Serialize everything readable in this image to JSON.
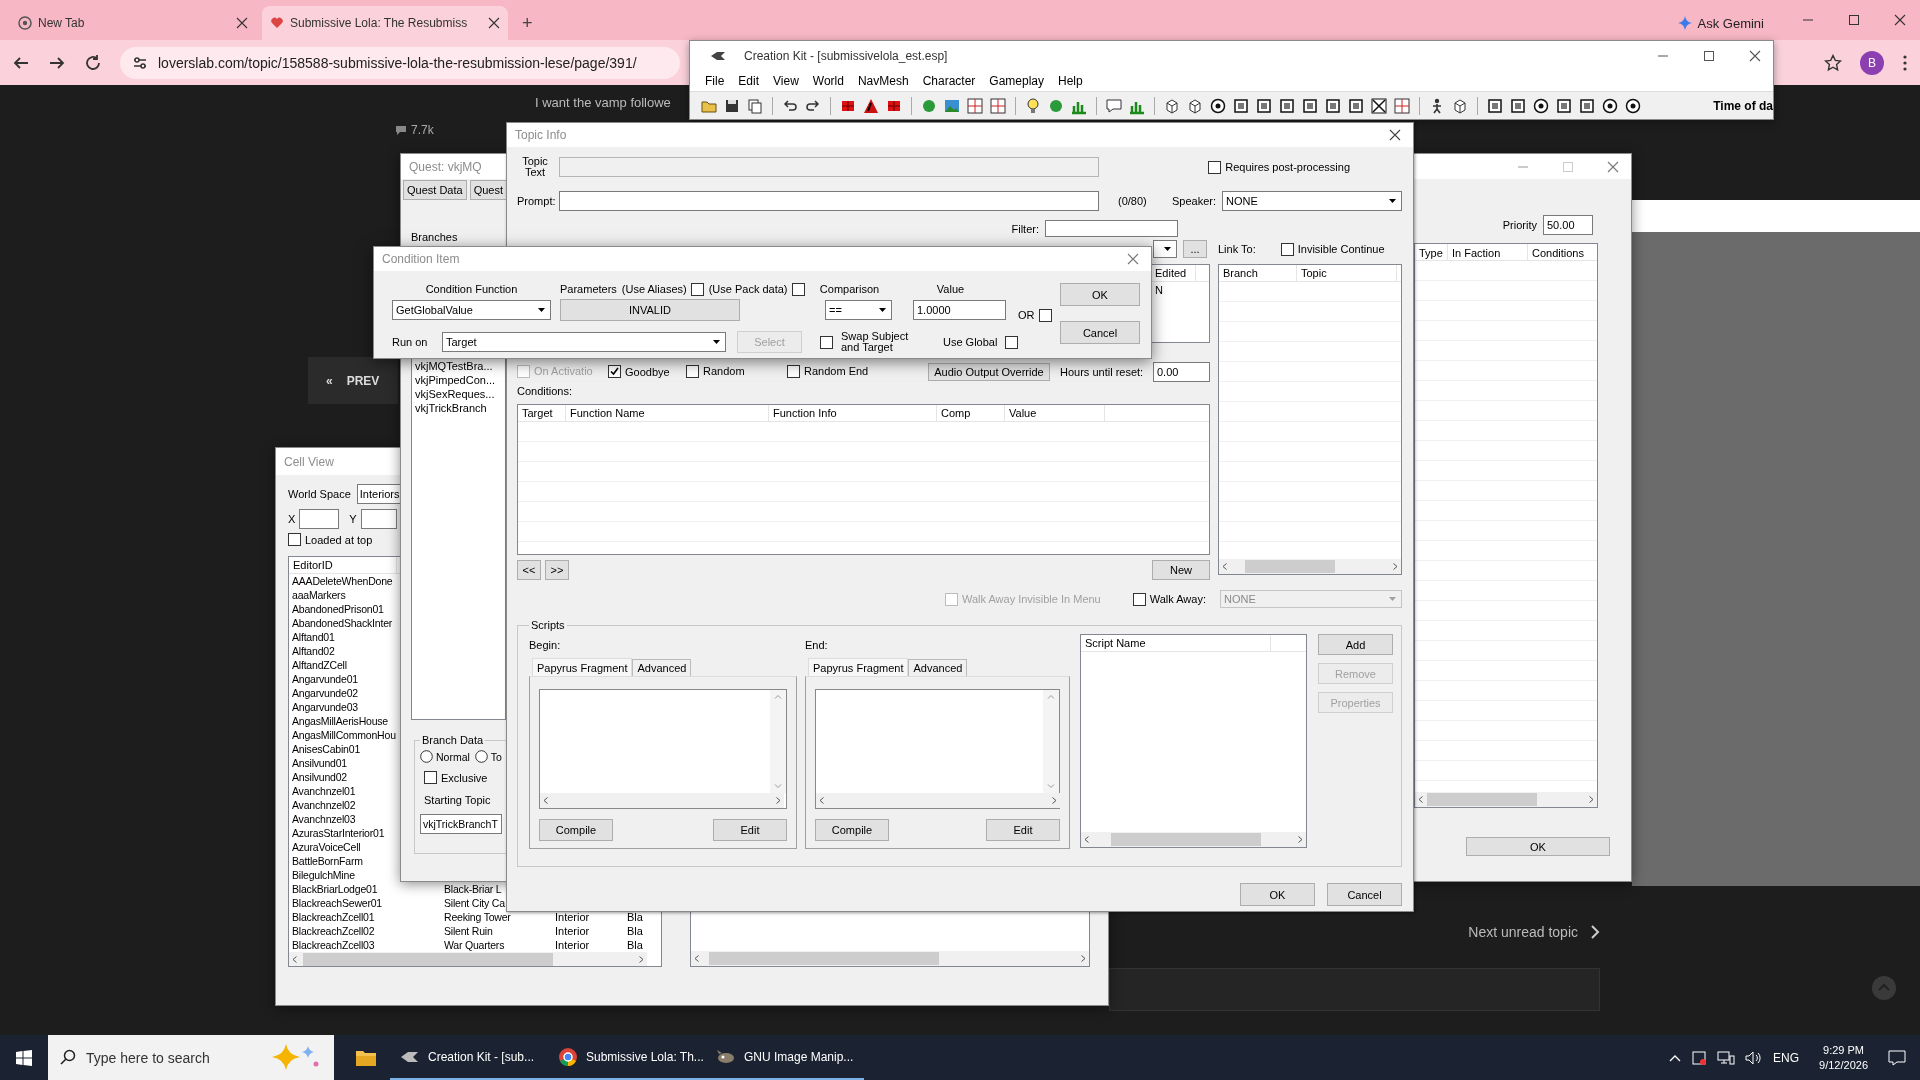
{
  "browser": {
    "tabs": [
      {
        "title": "New Tab",
        "selected": false
      },
      {
        "title": "Submissive Lola: The Resubmiss",
        "selected": true
      }
    ],
    "new_tab_button": "+",
    "gemini_button": "Ask Gemini",
    "url": "loverslab.com/topic/158588-submissive-lola-the-resubmission-lese/page/391/",
    "profile_initial": "B"
  },
  "web_page": {
    "view_count": "7.7k",
    "post_text": "I want the vamp followe",
    "prev_icon": "«",
    "prev_label": "PREV",
    "next_unread": "Next unread topic"
  },
  "creation_kit": {
    "title": "Creation Kit - [submissivelola_est.esp]",
    "menu": [
      "File",
      "Edit",
      "View",
      "World",
      "NavMesh",
      "Character",
      "Gameplay",
      "Help"
    ],
    "time_label": "Time of da"
  },
  "cell_view": {
    "title": "Cell View",
    "world_space_label": "World Space",
    "world_space": "Interiors",
    "x_label": "X",
    "y_label": "Y",
    "loaded_at_top": {
      "label": "Loaded at top",
      "checked": false
    },
    "column": "EditorID",
    "rows": [
      {
        "editor_id": "AAADeleteWhenDone"
      },
      {
        "editor_id": "aaaMarkers"
      },
      {
        "editor_id": "AbandonedPrison01"
      },
      {
        "editor_id": "AbandonedShackInter"
      },
      {
        "editor_id": "Alftand01"
      },
      {
        "editor_id": "Alftand02"
      },
      {
        "editor_id": "AlftandZCell"
      },
      {
        "editor_id": "Angarvunde01"
      },
      {
        "editor_id": "Angarvunde02"
      },
      {
        "editor_id": "Angarvunde03"
      },
      {
        "editor_id": "AngasMillAerisHouse"
      },
      {
        "editor_id": "AngasMillCommonHou"
      },
      {
        "editor_id": "AnisesCabin01"
      },
      {
        "editor_id": "Ansilvund01"
      },
      {
        "editor_id": "Ansilvund02"
      },
      {
        "editor_id": "Avanchnzel01"
      },
      {
        "editor_id": "Avanchnzel02"
      },
      {
        "editor_id": "Avanchnzel03"
      },
      {
        "editor_id": "AzurasStarInterior01"
      },
      {
        "editor_id": "AzuraVoiceCell"
      },
      {
        "editor_id": "BattleBornFarm"
      },
      {
        "editor_id": "BilegulchMine"
      },
      {
        "editor_id": "BlackBriarLodge01",
        "name": "Black-Briar L"
      },
      {
        "editor_id": "BlackreachSewer01",
        "name": "Silent City Ca"
      },
      {
        "editor_id": "BlackreachZcell01",
        "name": "Reeking Tower",
        "type": "Interior",
        "column_4": "Bla"
      },
      {
        "editor_id": "BlackreachZcell02",
        "name": "Silent Ruin",
        "type": "Interior",
        "column_4": "Bla"
      },
      {
        "editor_id": "BlackreachZcell03",
        "name": "War Quarters",
        "type": "Interior",
        "column_4": "Bla"
      }
    ]
  },
  "quest_window": {
    "title": "Quest: vkjMQ",
    "tabs": [
      {
        "label": "Quest Data",
        "selected": false
      },
      {
        "label": "Quest",
        "selected": false
      }
    ],
    "branches_label": "Branches",
    "branches": [
      "vkjMQTestBra...",
      "vkjPimpedCon...",
      "vkjSexReques...",
      "vkjTrickBranch"
    ],
    "branch_data": {
      "title": "Branch Data",
      "types": [
        {
          "label": "Normal",
          "selected": false
        },
        {
          "label": "To",
          "selected": false
        }
      ],
      "exclusive": {
        "label": "Exclusive",
        "checked": false
      },
      "starting_topic_label": "Starting Topic",
      "starting_topic": "vkjTrickBranchT"
    },
    "priority_label": "Priority",
    "priority": "50.00",
    "columns": [
      "Type",
      "In Faction",
      "Conditions"
    ],
    "ok": "OK"
  },
  "topic_info": {
    "title": "Topic Info",
    "topic_text_label": "Topic Text",
    "requires_post_processing": {
      "label": "Requires post-processing",
      "checked": false
    },
    "prompt_label": "Prompt:",
    "prompt_count": "(0/80)",
    "speaker_label": "Speaker:",
    "speaker": "NONE",
    "filter_label": "Filter:",
    "more_button": "...",
    "link_to_label": "Link To:",
    "invisible_continue": {
      "label": "Invisible Continue",
      "checked": false
    },
    "topic_list": {
      "column": "Edited",
      "value": "N"
    },
    "flags": [
      {
        "label": "On Activatio",
        "checked": false,
        "disabled": true
      },
      {
        "label": "Goodbye",
        "checked": true,
        "disabled": false
      },
      {
        "label": "Random",
        "checked": false,
        "disabled": false
      },
      {
        "label": "Random End",
        "checked": false,
        "disabled": false
      }
    ],
    "audio_output_override": "Audio Output Override",
    "hours_label": "Hours until reset:",
    "hours": "0.00",
    "conditions_label": "Conditions:",
    "condition_columns": [
      "Target",
      "Function Name",
      "Function Info",
      "Comp",
      "Value"
    ],
    "prev_button": "<<",
    "next_button": ">>",
    "new_button": "New",
    "walk_away_invisible": {
      "label": "Walk Away Invisible In Menu",
      "checked": false,
      "disabled": true
    },
    "walk_away": {
      "label": "Walk Away:",
      "checked": false
    },
    "walk_away_value": "NONE",
    "link_columns": [
      "Branch",
      "Topic"
    ],
    "scripts": {
      "title": "Scripts",
      "panes": [
        {
          "label": "Begin:",
          "tabs": [
            {
              "label": "Papyrus Fragment",
              "selected": true
            },
            {
              "label": "Advanced",
              "selected": false
            }
          ],
          "compile": "Compile",
          "edit": "Edit"
        },
        {
          "label": "End:",
          "tabs": [
            {
              "label": "Papyrus Fragment",
              "selected": true
            },
            {
              "label": "Advanced",
              "selected": false
            }
          ],
          "compile": "Compile",
          "edit": "Edit"
        }
      ],
      "script_name_column": "Script Name",
      "buttons": [
        {
          "label": "Add",
          "disabled": false
        },
        {
          "label": "Remove",
          "disabled": true
        },
        {
          "label": "Properties",
          "disabled": true
        }
      ]
    },
    "ok": "OK",
    "cancel": "Cancel"
  },
  "condition_item": {
    "title": "Condition Item",
    "function_label": "Condition Function",
    "function": "GetGlobalValue",
    "parameters_label": "Parameters",
    "use_aliases": {
      "label": "(Use Aliases)",
      "checked": false
    },
    "use_pack_data": {
      "label": "(Use Pack data)",
      "checked": false
    },
    "parameter": "INVALID",
    "comparison_label": "Comparison",
    "comparison": "==",
    "value_label": "Value",
    "value": "1.0000",
    "or": {
      "label": "OR",
      "checked": false
    },
    "run_on_label": "Run on",
    "run_on": "Target",
    "select_button": {
      "label": "Select",
      "disabled": true
    },
    "swap": {
      "label": "Swap Subject and Target",
      "checked": false
    },
    "use_global": {
      "label": "Use Global",
      "checked": false
    },
    "ok": "OK",
    "cancel": "Cancel"
  },
  "taskbar": {
    "search_placeholder": "Type here to search",
    "apps": [
      {
        "label": "Creation Kit - [sub...",
        "kind": "ck"
      },
      {
        "label": "Submissive Lola: Th...",
        "kind": "browser"
      },
      {
        "label": "GNU Image Manip...",
        "kind": "gimp"
      }
    ],
    "language": "ENG",
    "time": "9:29 PM",
    "date": "9/12/2026"
  }
}
